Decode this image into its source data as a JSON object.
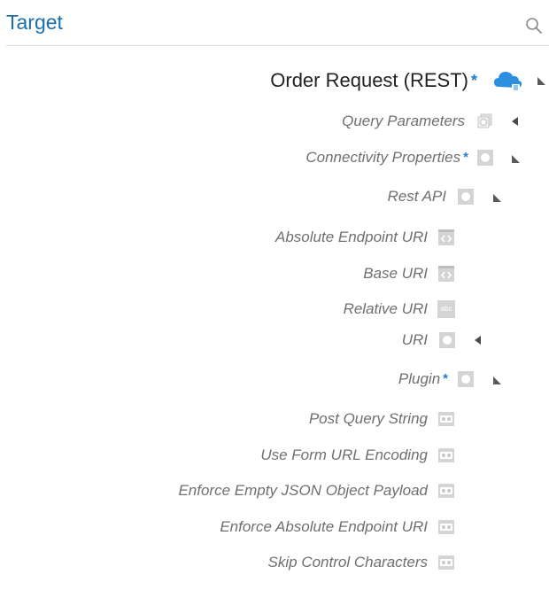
{
  "header": {
    "title": "Target"
  },
  "tree": {
    "root": {
      "label": "Order Request (REST)",
      "required": "*"
    },
    "query_parameters": {
      "label": "Query Parameters"
    },
    "connectivity_properties": {
      "label": "Connectivity Properties",
      "required": "*"
    },
    "rest_api": {
      "label": "Rest API"
    },
    "absolute_endpoint_uri": {
      "label": "Absolute Endpoint URI"
    },
    "base_uri": {
      "label": "Base URI"
    },
    "relative_uri": {
      "label": "Relative URI",
      "icon_text": "abc"
    },
    "uri": {
      "label": "URI"
    },
    "plugin": {
      "label": "Plugin",
      "required": "*"
    },
    "post_query_string": {
      "label": "Post Query String"
    },
    "use_form_url_encoding": {
      "label": "Use Form URL Encoding"
    },
    "enforce_empty_json_object_payload": {
      "label": "Enforce Empty JSON Object Payload"
    },
    "enforce_absolute_endpoint_uri": {
      "label": "Enforce Absolute Endpoint URI"
    },
    "skip_control_characters": {
      "label": "Skip Control Characters"
    }
  },
  "colors": {
    "title": "#1b6fad",
    "required_star": "#1f7bd0",
    "cloud": "#2d8fe0",
    "icon_gray": "#c8c8c8",
    "label_gray": "#6f6f6f"
  },
  "icons": {
    "search": "search-icon",
    "cloud": "rest-cloud-icon",
    "collection": "collection-icon",
    "element": "element-icon",
    "uri": "uri-code-icon",
    "text": "text-abc-icon",
    "boolean": "boolean-toggle-icon",
    "expanded": "triangle-expanded-icon",
    "collapsed": "triangle-collapsed-icon"
  }
}
